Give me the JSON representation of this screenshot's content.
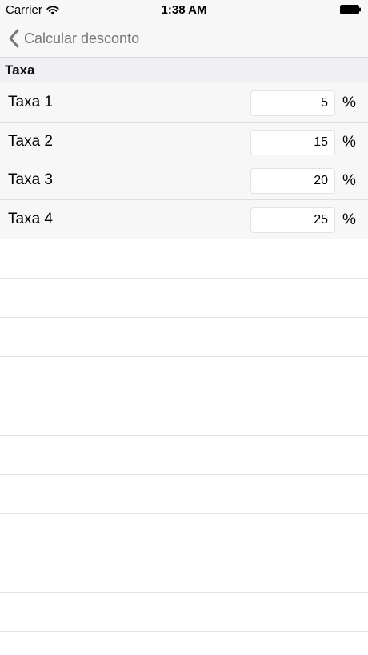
{
  "status_bar": {
    "carrier": "Carrier",
    "time": "1:38 AM",
    "icons": {
      "wifi": "wifi-icon",
      "battery": "battery-icon"
    }
  },
  "nav": {
    "back_label": "Calcular desconto",
    "back_icon": "chevron-left-icon"
  },
  "section": {
    "title": "Taxa"
  },
  "rates": [
    {
      "label": "Taxa 1",
      "value": "5",
      "unit": "%"
    },
    {
      "label": "Taxa 2",
      "value": "15",
      "unit": "%"
    },
    {
      "label": "Taxa 3",
      "value": "20",
      "unit": "%"
    },
    {
      "label": "Taxa 4",
      "value": "25",
      "unit": "%"
    }
  ],
  "colors": {
    "bar_background": "#f7f7f7",
    "section_background": "#efeff4",
    "back_text": "#777777"
  }
}
